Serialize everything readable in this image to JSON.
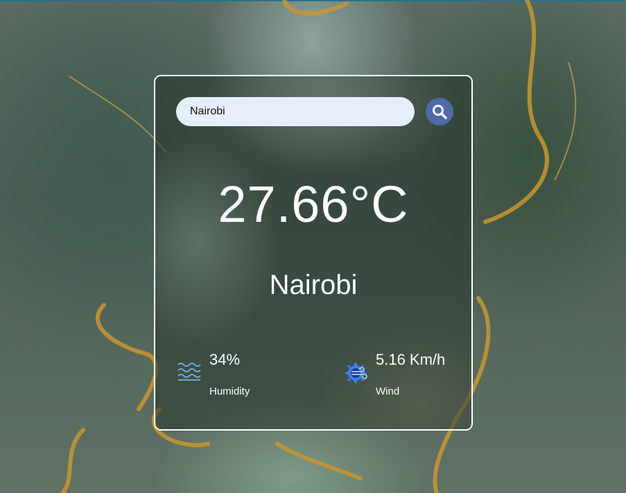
{
  "search": {
    "value": "Nairobi"
  },
  "weather": {
    "temperature": "27.66°C",
    "city": "Nairobi"
  },
  "humidity": {
    "value": "34%",
    "label": "Humidity",
    "icon": "waves-icon"
  },
  "wind": {
    "value": "5.16 Km/h",
    "label": "Wind",
    "icon": "wind-sun-icon"
  },
  "colors": {
    "search_button": "#4e6aa8",
    "input_bg": "#e8eef9",
    "text": "#ffffff",
    "wind_icon": "#3b82f6",
    "humidity_icon": "#6fa8d8"
  }
}
